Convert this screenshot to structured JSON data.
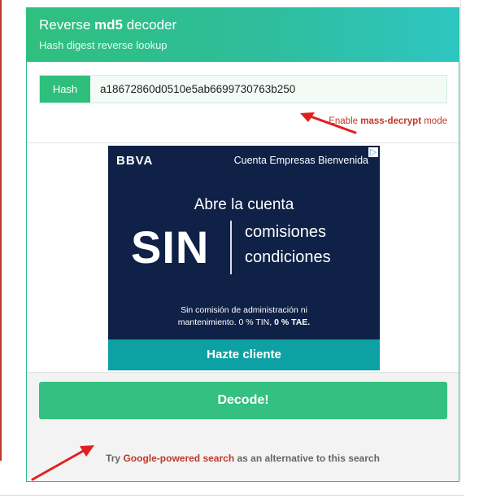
{
  "header": {
    "title_prefix": "Reverse ",
    "title_bold": "md5",
    "title_suffix": " decoder",
    "subtitle": "Hash digest reverse lookup"
  },
  "hash": {
    "label": "Hash",
    "value": "a18672860d0510e5ab6699730763b250"
  },
  "mass_decrypt": {
    "prefix": "Enable ",
    "link": "mass-decrypt",
    "suffix": " mode"
  },
  "ad": {
    "brand": "BBVA",
    "tagline": "Cuenta Empresas Bienvenida",
    "headline": "Abre la cuenta",
    "big_word": "SIN",
    "line1": "comisiones",
    "line2": "condiciones",
    "fine_print_1": "Sin comisión de administración ni",
    "fine_print_2_prefix": "mantenimiento. 0 % TIN, ",
    "fine_print_2_bold": "0 % TAE.",
    "cta": "Hazte cliente",
    "choices_icon": "adchoices-icon"
  },
  "actions": {
    "decode_label": "Decode!"
  },
  "alternative": {
    "prefix": "Try ",
    "link": "Google-powered search",
    "suffix": " as an alternative to this search"
  },
  "colors": {
    "accent": "#2fbf7d",
    "link_red": "#c0392b",
    "ad_bg": "#0f2147",
    "ad_cta": "#0da1a4"
  }
}
